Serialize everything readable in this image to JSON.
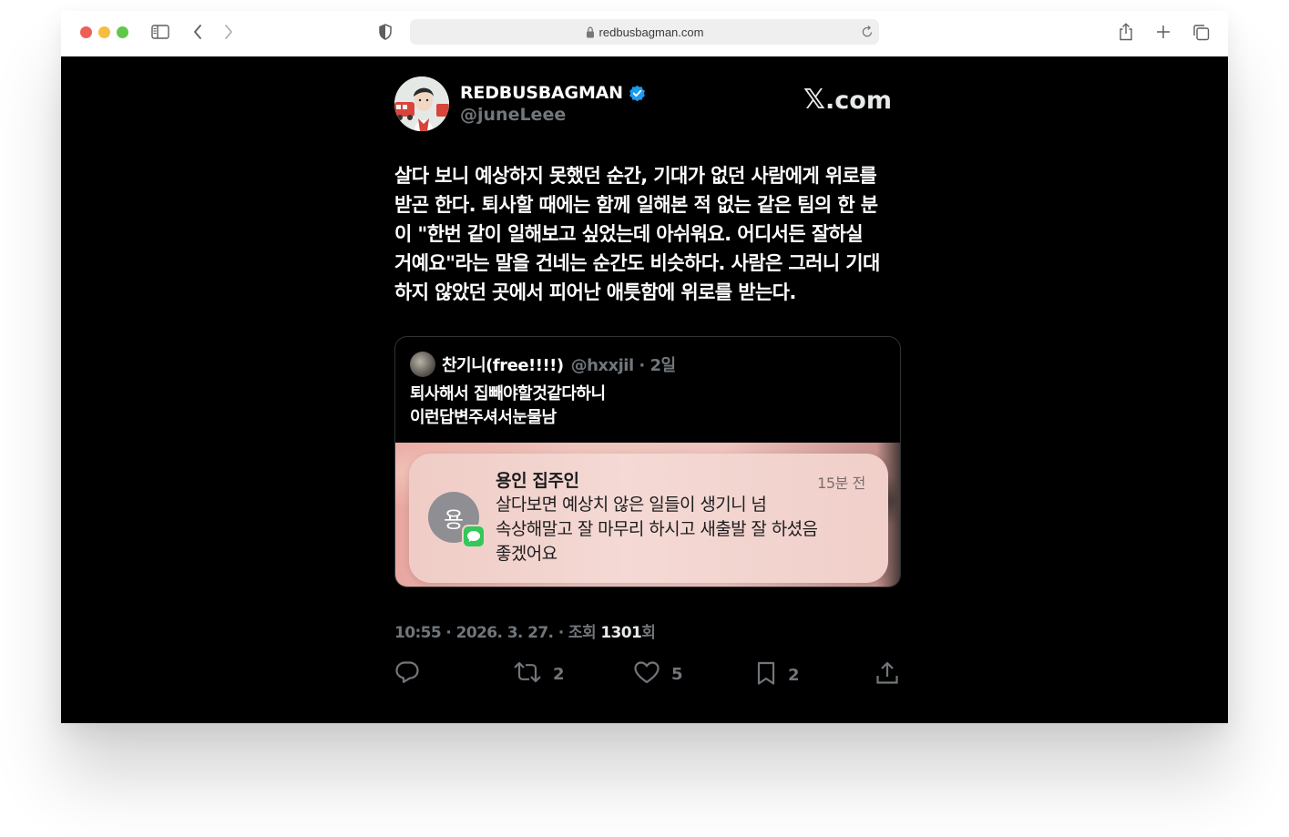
{
  "browser": {
    "url": "redbusbagman.com",
    "icons": [
      "sidebar-icon",
      "back-icon",
      "forward-icon",
      "shield-icon",
      "lock-icon",
      "reload-icon",
      "share-icon",
      "new-tab-icon",
      "tabs-overview-icon"
    ]
  },
  "tweet": {
    "display_name": "REDBUSBAGMAN",
    "handle": "@juneLeee",
    "site": ".com",
    "site_mark": "𝕏",
    "text_lines": [
      "살다 보니 예상하지 못했던 순간, 기대가 없던 사람에게 위로를",
      "받곤 한다. 퇴사할 때에는 함께 일해본 적 없는 같은 팀의 한 분",
      "이 \"한번 같이 일해보고 싶었는데 아쉬워요. 어디서든 잘하실",
      "거예요\"라는 말을 건네는 순간도 비슷하다. 사람은 그러니 기대",
      "하지 않았던 곳에서 피어난 애틋함에 위로를 받는다."
    ],
    "quote": {
      "name": "찬기니(free!!!!)",
      "meta": "@hxxjil · 2일",
      "text_lines": [
        "퇴사해서 집빼야할것같다하니",
        "이런답변주셔서눈물남"
      ],
      "notification": {
        "avatar_letter": "용",
        "title": "용인 집주인",
        "time": "15분 전",
        "body_lines": [
          "살다보면 예상치 않은 일들이 생기니 넘",
          "속상해말고 잘 마무리 하시고 새출발 잘 하셨음",
          "좋겠어요"
        ]
      }
    },
    "timestamp": "10:55 · 2026. 3. 27. · 조회 ",
    "views": "1301",
    "views_suffix": "회",
    "actions": {
      "reply_count": "",
      "retweet_count": "2",
      "like_count": "5",
      "bookmark_count": "2"
    },
    "colors": {
      "verified": "#1d9bf0",
      "background": "#000000",
      "muted": "#71767b"
    }
  }
}
